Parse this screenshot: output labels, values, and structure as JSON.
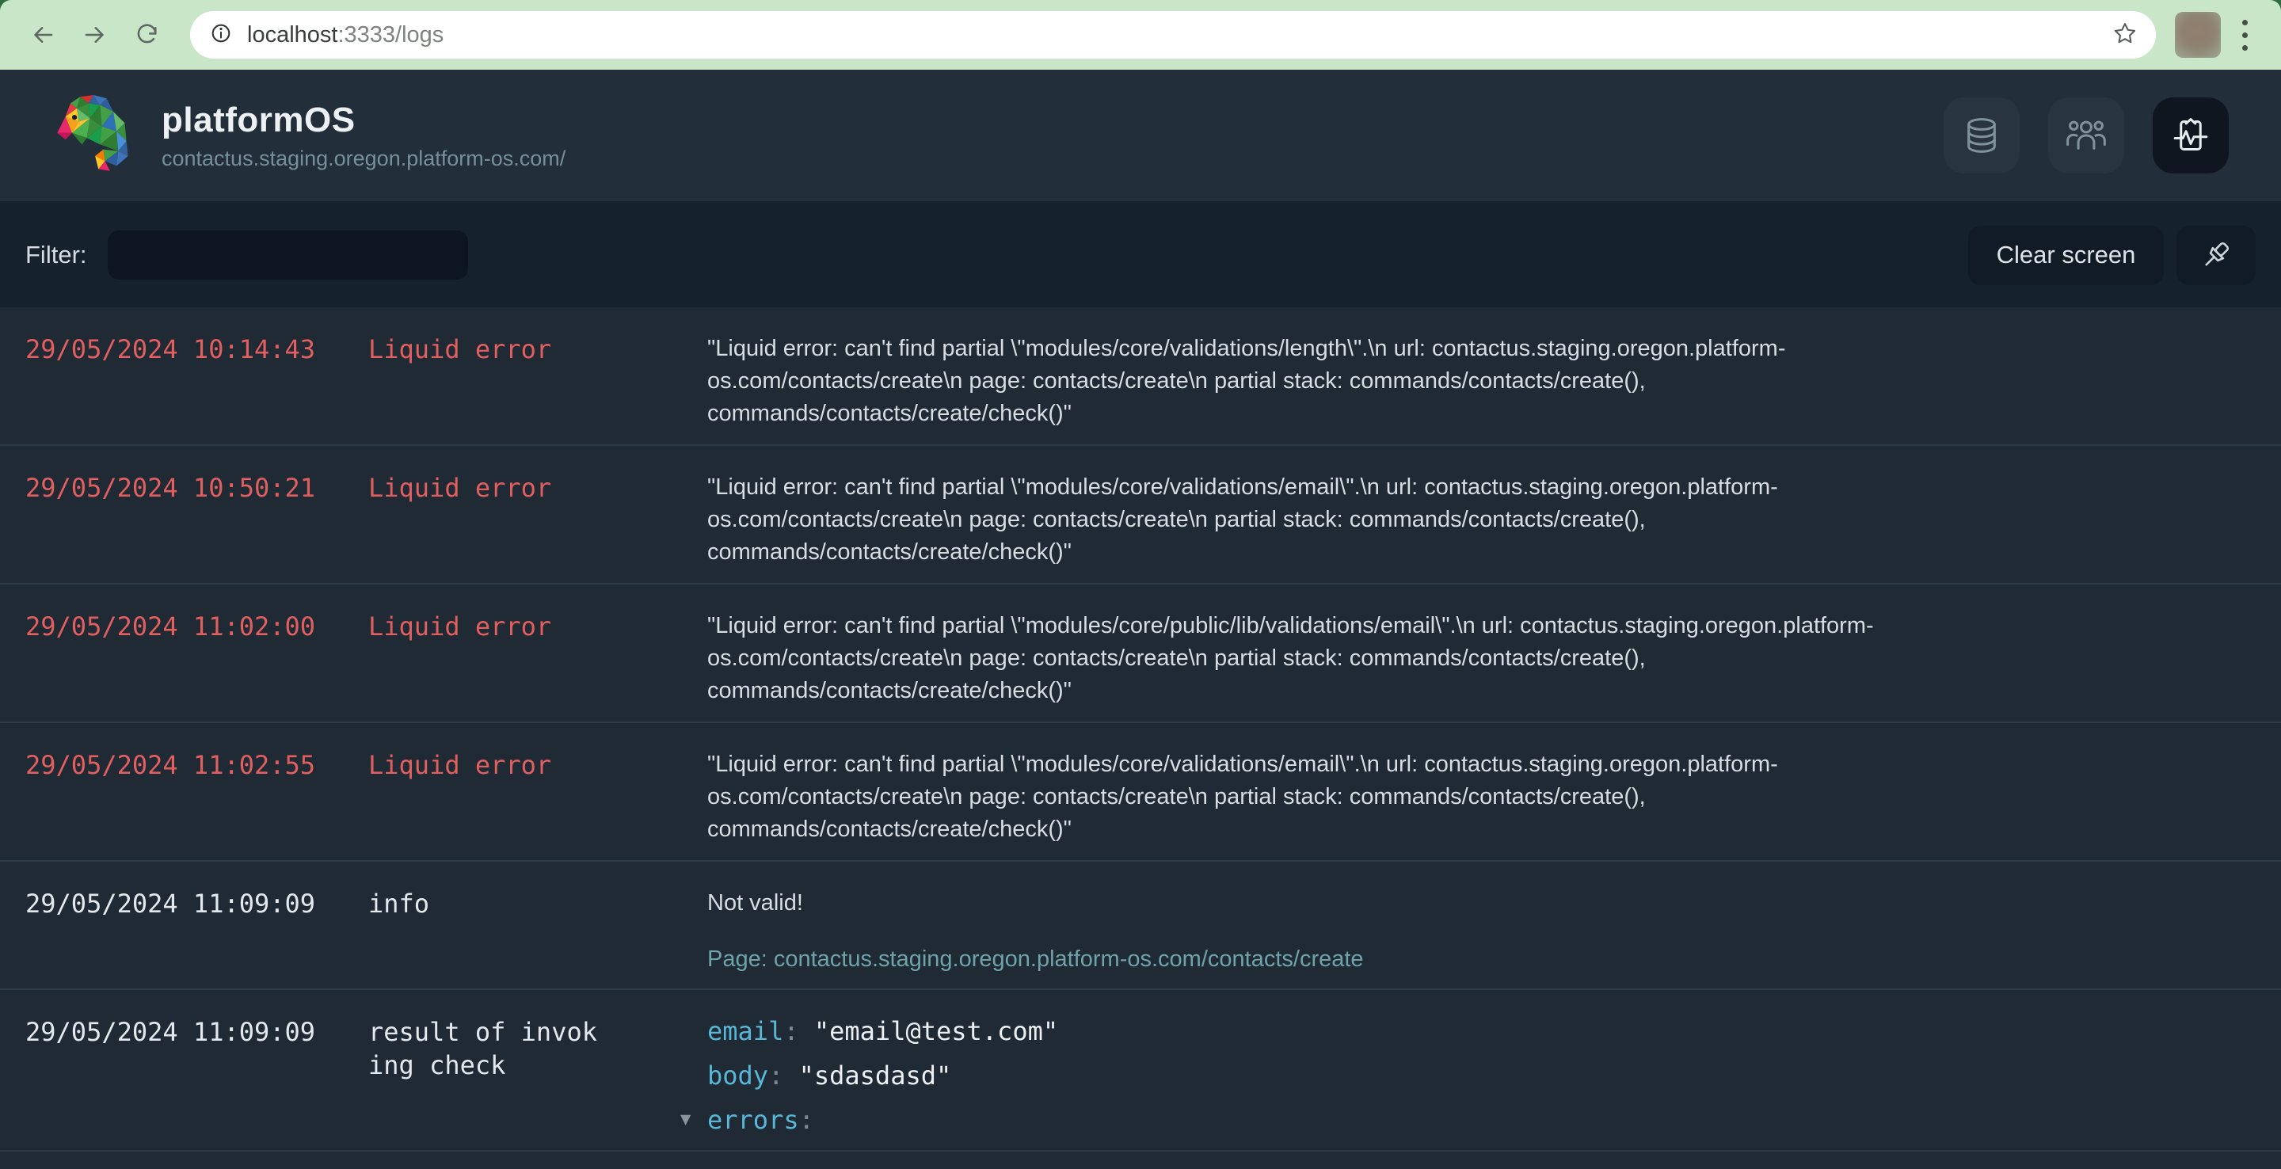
{
  "browser": {
    "url_host": "localhost",
    "url_path": ":3333/logs"
  },
  "header": {
    "brand": "platformOS",
    "instance": "contactus.staging.oregon.platform-os.com/",
    "icons": [
      "database-icon",
      "users-icon",
      "logs-activity-icon"
    ]
  },
  "toolbar": {
    "filter_label": "Filter:",
    "filter_value": "",
    "clear_label": "Clear screen",
    "pin_icon": "pushpin-icon"
  },
  "logs": [
    {
      "time": "29/05/2024 10:14:43",
      "level": "Liquid error",
      "variant": "error",
      "message": "\"Liquid error: can't find partial \\\"modules/core/validations/length\\\".\\n url: contactus.staging.oregon.platform-os.com/contacts/create\\n page: contacts/create\\n partial stack: commands/contacts/create(), commands/contacts/create/check()\""
    },
    {
      "time": "29/05/2024 10:50:21",
      "level": "Liquid error",
      "variant": "error",
      "message": "\"Liquid error: can't find partial \\\"modules/core/validations/email\\\".\\n url: contactus.staging.oregon.platform-os.com/contacts/create\\n page: contacts/create\\n partial stack: commands/contacts/create(), commands/contacts/create/check()\""
    },
    {
      "time": "29/05/2024 11:02:00",
      "level": "Liquid error",
      "variant": "error",
      "message": "\"Liquid error: can't find partial \\\"modules/core/public/lib/validations/email\\\".\\n url: contactus.staging.oregon.platform-os.com/contacts/create\\n page: contacts/create\\n partial stack: commands/contacts/create(), commands/contacts/create/check()\""
    },
    {
      "time": "29/05/2024 11:02:55",
      "level": "Liquid error",
      "variant": "error",
      "message": "\"Liquid error: can't find partial \\\"modules/core/validations/email\\\".\\n url: contactus.staging.oregon.platform-os.com/contacts/create\\n page: contacts/create\\n partial stack: commands/contacts/create(), commands/contacts/create/check()\""
    },
    {
      "time": "29/05/2024 11:09:09",
      "level": "info",
      "variant": "info",
      "message": "Not valid!",
      "page_link": "Page: contactus.staging.oregon.platform-os.com/contacts/create"
    },
    {
      "time": "29/05/2024 11:09:09",
      "level": "result of invoking check",
      "variant": "info",
      "entries": [
        {
          "key": "email",
          "value": "\"email@test.com\""
        },
        {
          "key": "body",
          "value": "\"sdasdasd\""
        }
      ],
      "tree": [
        {
          "caret": "▼",
          "key": "errors"
        }
      ]
    }
  ],
  "colors": {
    "error_red": "#e25f5f",
    "json_key_cyan": "#58b7d6",
    "link_teal": "#6fa3aa",
    "chrome_green": "#c9e6c9",
    "bg_dark": "#1f2a35"
  }
}
